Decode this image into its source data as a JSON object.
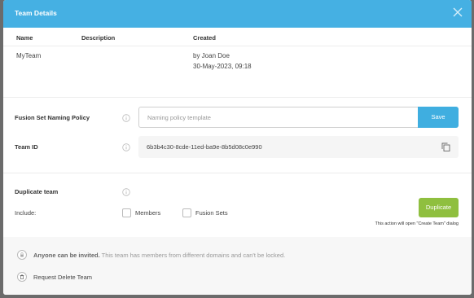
{
  "dialog": {
    "title": "Team Details",
    "close_icon": "close-icon"
  },
  "table": {
    "headers": [
      "Name",
      "Description",
      "Created"
    ],
    "row": {
      "name": "MyTeam",
      "description": "",
      "created_by": "by Joan Doe",
      "created_at": "30-May-2023, 09:18"
    }
  },
  "naming_policy": {
    "label": "Fusion Set Naming Policy",
    "placeholder": "Naming policy template",
    "value": "",
    "save_label": "Save"
  },
  "team_id": {
    "label": "Team ID",
    "value": "6b3b4c30-8cde-11ed-ba9e-8b5d08c0e990"
  },
  "duplicate": {
    "label": "Duplicate team",
    "include_label": "Include:",
    "options": [
      {
        "label": "Members",
        "checked": false
      },
      {
        "label": "Fusion Sets",
        "checked": false
      }
    ],
    "button_label": "Duplicate",
    "note": "This action will open \"Create Team\" dialog"
  },
  "footer": {
    "invite_bold": "Anyone can be invited.",
    "invite_text": "This team has members from different domains and can't be locked.",
    "delete_label": "Request Delete Team"
  },
  "colors": {
    "header": "#45b0e3",
    "save": "#3faee0",
    "duplicate": "#8fbf3f"
  }
}
